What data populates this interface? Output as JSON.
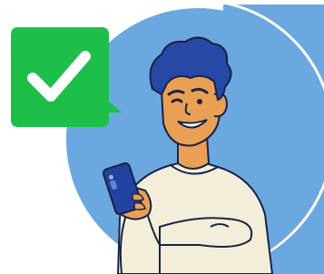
{
  "illustration": {
    "background_color": "#6aa8df",
    "check_badge_color": "#1dbf4a",
    "check_mark_color": "#ffffff",
    "skin_color": "#e9a055",
    "hair_color": "#2848a6",
    "shirt_color": "#f3eed9",
    "phone_color": "#2343a0",
    "outline_color": "#1b2245"
  }
}
